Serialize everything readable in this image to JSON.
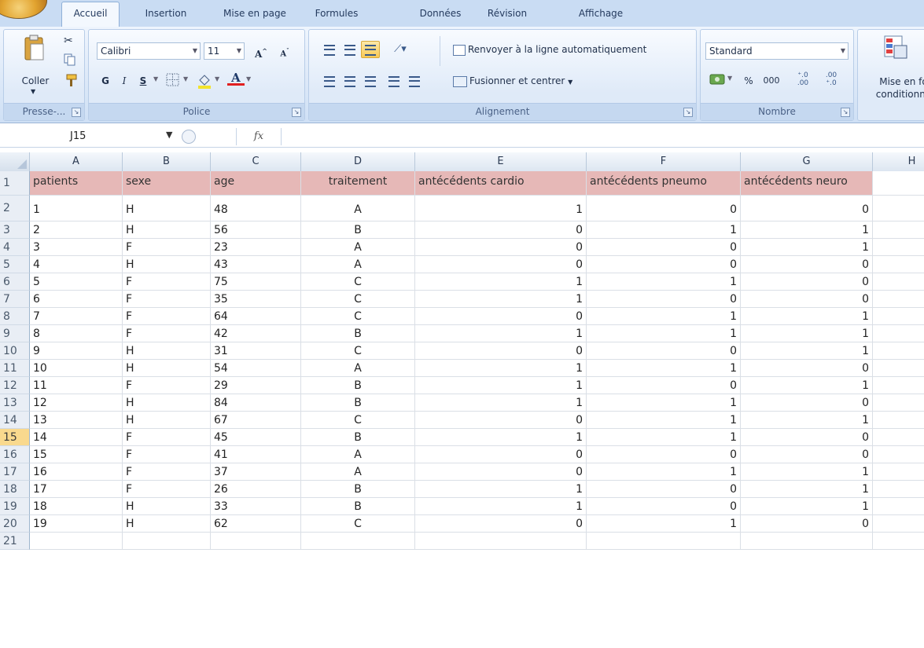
{
  "tabs": [
    "Accueil",
    "Insertion",
    "Mise en page",
    "Formules",
    "Données",
    "Révision",
    "Affichage"
  ],
  "ribbon": {
    "clipboard": {
      "paste_label": "Coller",
      "group_label": "Presse-..."
    },
    "font": {
      "font_name": "Calibri",
      "font_size": "11",
      "bold": "G",
      "italic": "I",
      "underline": "S",
      "group_label": "Police"
    },
    "alignment": {
      "wrap_text": "Renvoyer à la ligne automatiquement",
      "merge_center": "Fusionner et centrer",
      "group_label": "Alignement"
    },
    "number": {
      "format": "Standard",
      "percent": "%",
      "thousands": "000",
      "group_label": "Nombre"
    },
    "styles": {
      "conditional_line1": "Mise en fo",
      "conditional_line2": "conditionne"
    }
  },
  "formula_bar": {
    "name_box": "J15",
    "fx_label": "fx",
    "content": ""
  },
  "columns": [
    "A",
    "B",
    "C",
    "D",
    "E",
    "F",
    "G",
    "H"
  ],
  "selected_row": 15,
  "headers": [
    "patients",
    "sexe",
    "age",
    "traitement",
    "antécédents cardio",
    "antécédents pneumo",
    "antécédents neuro"
  ],
  "rows": [
    [
      "1",
      "H",
      "48",
      "A",
      "1",
      "0",
      "0"
    ],
    [
      "2",
      "H",
      "56",
      "B",
      "0",
      "1",
      "1"
    ],
    [
      "3",
      "F",
      "23",
      "A",
      "0",
      "0",
      "1"
    ],
    [
      "4",
      "H",
      "43",
      "A",
      "0",
      "0",
      "0"
    ],
    [
      "5",
      "F",
      "75",
      "C",
      "1",
      "1",
      "0"
    ],
    [
      "6",
      "F",
      "35",
      "C",
      "1",
      "0",
      "0"
    ],
    [
      "7",
      "F",
      "64",
      "C",
      "0",
      "1",
      "1"
    ],
    [
      "8",
      "F",
      "42",
      "B",
      "1",
      "1",
      "1"
    ],
    [
      "9",
      "H",
      "31",
      "C",
      "0",
      "0",
      "1"
    ],
    [
      "10",
      "H",
      "54",
      "A",
      "1",
      "1",
      "0"
    ],
    [
      "11",
      "F",
      "29",
      "B",
      "1",
      "0",
      "1"
    ],
    [
      "12",
      "H",
      "84",
      "B",
      "1",
      "1",
      "0"
    ],
    [
      "13",
      "H",
      "67",
      "C",
      "0",
      "1",
      "1"
    ],
    [
      "14",
      "F",
      "45",
      "B",
      "1",
      "1",
      "0"
    ],
    [
      "15",
      "F",
      "41",
      "A",
      "0",
      "0",
      "0"
    ],
    [
      "16",
      "F",
      "37",
      "A",
      "0",
      "1",
      "1"
    ],
    [
      "17",
      "F",
      "26",
      "B",
      "1",
      "0",
      "1"
    ],
    [
      "18",
      "H",
      "33",
      "B",
      "1",
      "0",
      "1"
    ],
    [
      "19",
      "H",
      "62",
      "C",
      "0",
      "1",
      "0"
    ]
  ],
  "row_numbers": [
    "1",
    "2",
    "3",
    "4",
    "5",
    "6",
    "7",
    "8",
    "9",
    "10",
    "11",
    "12",
    "13",
    "14",
    "15",
    "16",
    "17",
    "18",
    "19",
    "20",
    "21"
  ],
  "colors": {
    "header_fill": "#e6b8b7",
    "selected_row_header": "#f9d98e",
    "ribbon": "#dde9f8"
  }
}
